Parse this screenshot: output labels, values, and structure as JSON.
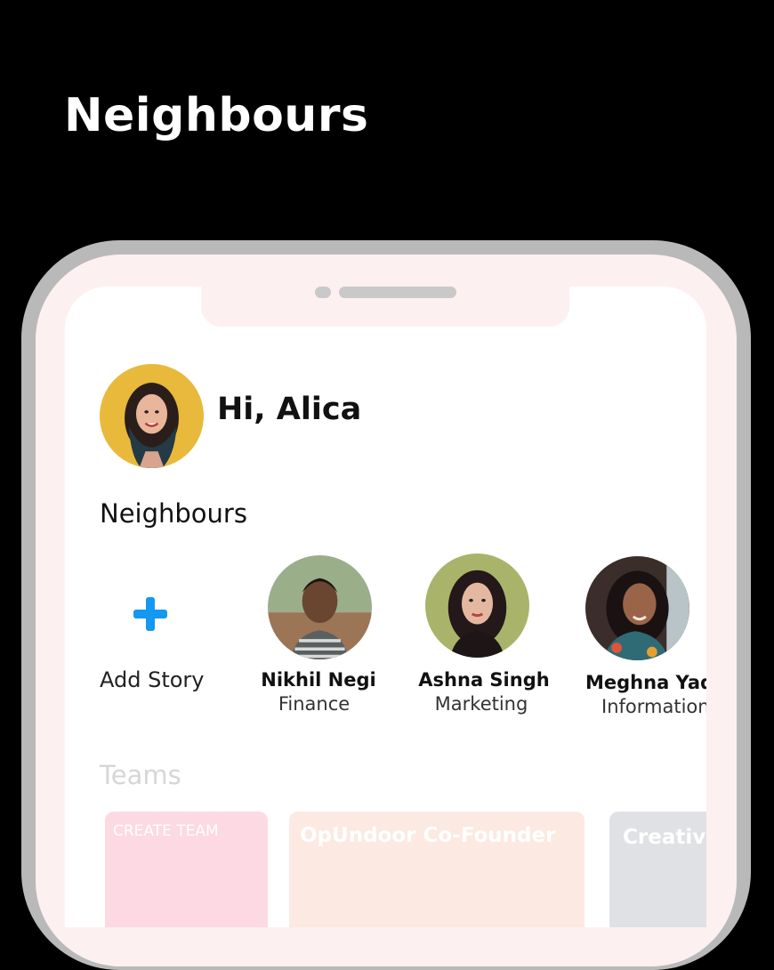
{
  "page": {
    "heading": "Neighbours"
  },
  "user": {
    "greeting": "Hi, Alica"
  },
  "neighbours_section": {
    "title": "Neighbours",
    "add_story_label": "Add Story",
    "people": [
      {
        "name": "Nikhil Negi",
        "role": "Finance"
      },
      {
        "name": "Ashna Singh",
        "role": "Marketing"
      },
      {
        "name": "Meghna Yadav",
        "role": "Information"
      }
    ]
  },
  "teams_section": {
    "title": "Teams",
    "cards": [
      {
        "label": "CREATE TEAM",
        "color": "#fcd9e3"
      },
      {
        "label": "OpUndoor Co-Founder",
        "color": "#fbe9e2"
      },
      {
        "label": "Creative",
        "color": "#dfe1e4"
      }
    ]
  },
  "colors": {
    "accent": "#1498f0",
    "bezel": "#fdf0f1",
    "frame": "#b9b9b9"
  }
}
